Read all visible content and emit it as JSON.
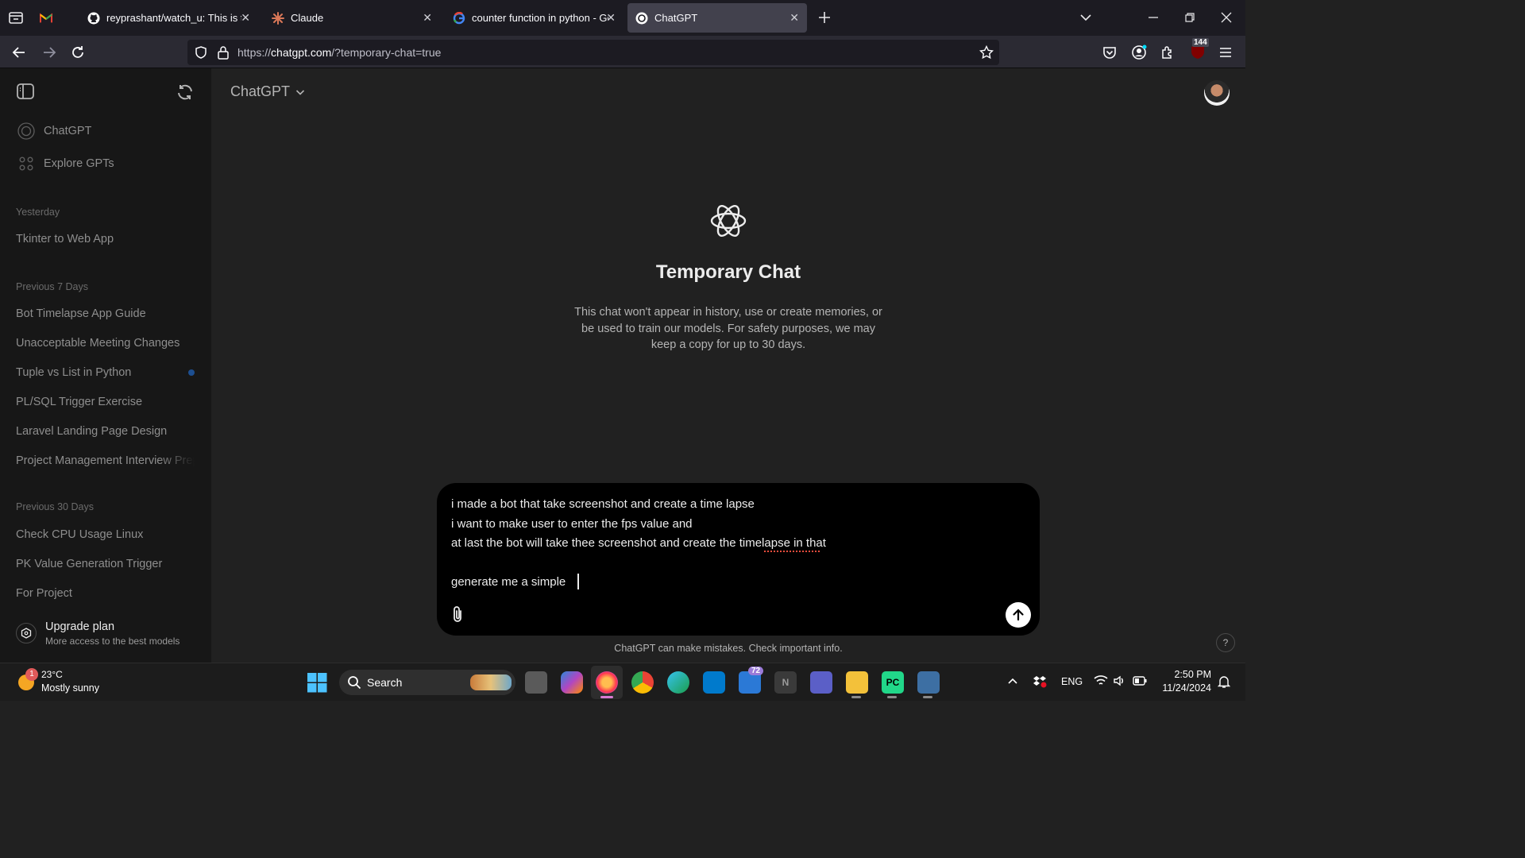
{
  "browser": {
    "tabs": [
      {
        "title": "",
        "icon": "gmail-icon",
        "active": false
      },
      {
        "title": "reyprashant/watch_u: This is the",
        "icon": "github-icon",
        "active": false
      },
      {
        "title": "Claude",
        "icon": "claude-icon",
        "active": false
      },
      {
        "title": "counter function in python - Go",
        "icon": "google-icon",
        "active": false
      },
      {
        "title": "ChatGPT",
        "icon": "chatgpt-icon",
        "active": true
      }
    ],
    "url_prefix": "https://",
    "url_domain": "chatgpt.com",
    "url_path": "/?temporary-chat=true",
    "notification_badge": "144"
  },
  "sidebar": {
    "top_items": [
      {
        "label": "ChatGPT",
        "icon": "chatgpt-icon"
      },
      {
        "label": "Explore GPTs",
        "icon": "grid-icon"
      }
    ],
    "sections": [
      {
        "title": "Yesterday",
        "items": [
          "Tkinter to Web App"
        ]
      },
      {
        "title": "Previous 7 Days",
        "items": [
          "Bot Timelapse App Guide",
          "Unacceptable Meeting Changes",
          "Tuple vs List in Python",
          "PL/SQL Trigger Exercise",
          "Laravel Landing Page Design",
          "Project Management Interview Prep"
        ]
      },
      {
        "title": "Previous 30 Days",
        "items": [
          "Check CPU Usage Linux",
          "PK Value Generation Trigger",
          "For Project"
        ]
      }
    ],
    "upgrade": {
      "title": "Upgrade plan",
      "subtitle": "More access to the best models"
    }
  },
  "header": {
    "model_name": "ChatGPT"
  },
  "temporary_chat": {
    "title": "Temporary Chat",
    "description_1": "This chat won't appear in history, use or create memories, or",
    "description_2": "be used to train our models. For safety purposes, we may",
    "description_3": "keep a copy for up to 30 days."
  },
  "composer": {
    "lines": [
      "i made a bot that take screenshot and create a time lapse",
      "i want to make user to enter the fps value and",
      "at last the bot will take thee screenshot and create the timelapse in that",
      "",
      "generate me a simple "
    ]
  },
  "footer_note": "ChatGPT can make mistakes. Check important info.",
  "help_label": "?",
  "taskbar": {
    "weather_temp": "23°C",
    "weather_desc": "Mostly sunny",
    "weather_badge": "1",
    "search_label": "Search",
    "mail_badge": "72",
    "language": "ENG",
    "time": "2:50 PM",
    "date": "11/24/2024"
  }
}
